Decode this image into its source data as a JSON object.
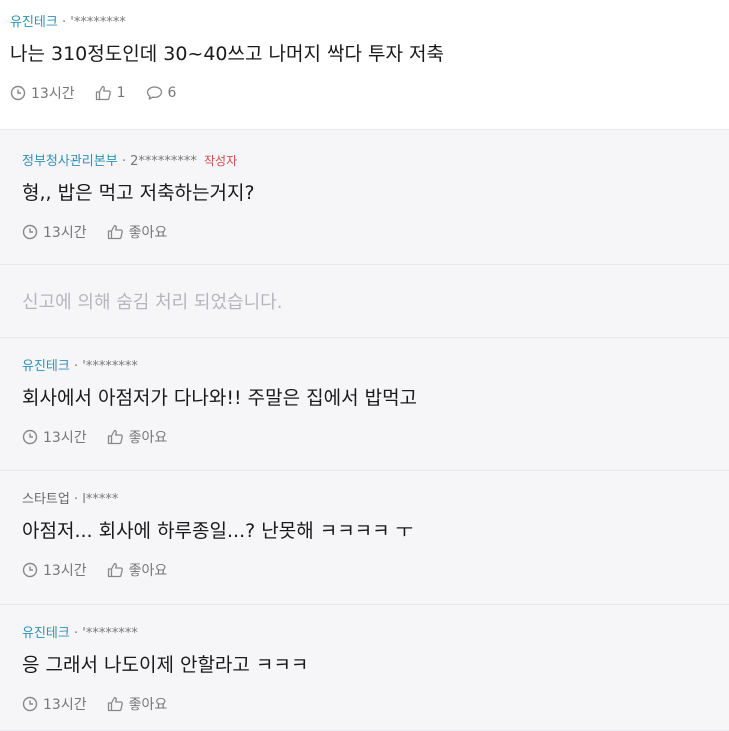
{
  "post": {
    "company": "유진테크",
    "user": "'********",
    "content": "나는 310정도인데 30~40쓰고 나머지 싹다 투자 저축",
    "time": "13시간",
    "likes": "1",
    "comments": "6"
  },
  "replies": [
    {
      "company": "정부청사관리본부",
      "user": "2*********",
      "badge": "작성자",
      "content": "형,, 밥은 먹고 저축하는거지?",
      "time": "13시간",
      "like_label": "좋아요"
    },
    {
      "hidden_text": "신고에 의해 숨김 처리 되었습니다."
    },
    {
      "company": "유진테크",
      "user": "'********",
      "content": "회사에서 아점저가 다나와!! 주말은 집에서 밥먹고",
      "time": "13시간",
      "like_label": "좋아요"
    },
    {
      "company": "스타트업",
      "user": "l*****",
      "content": "아점저... 회사에 하루종일...? 난못해 ㅋㅋㅋㅋ ㅜ",
      "time": "13시간",
      "like_label": "좋아요"
    },
    {
      "company": "유진테크",
      "user": "'********",
      "content": "응 그래서 나도이제 안할라고 ㅋㅋㅋ",
      "time": "13시간",
      "like_label": "좋아요"
    }
  ],
  "colors": {
    "company_link": "#2f92b5",
    "author_badge": "#d24b4b",
    "reply_background": "#f6f6f8",
    "hidden_text": "#b6b6bd"
  },
  "icons": [
    "clock-icon",
    "thumbs-up-icon",
    "comment-icon"
  ]
}
